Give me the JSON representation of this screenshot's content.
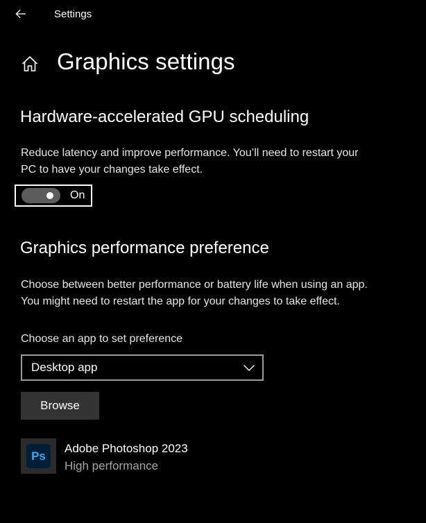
{
  "window": {
    "title": "Settings"
  },
  "page": {
    "title": "Graphics settings"
  },
  "gpu_scheduling": {
    "heading": "Hardware-accelerated GPU scheduling",
    "description_line1": "Reduce latency and improve performance. You’ll need to restart your",
    "description_line2": "PC to have your changes take effect.",
    "toggle_state": "On"
  },
  "performance_preference": {
    "heading": "Graphics performance preference",
    "description_line1": "Choose between better performance or battery life when using an app.",
    "description_line2": "You might need to restart the app for your changes to take effect.",
    "dropdown_label": "Choose an app to set preference",
    "dropdown_value": "Desktop app",
    "browse_label": "Browse"
  },
  "apps": [
    {
      "icon": "photoshop-icon",
      "icon_text": "Ps",
      "name": "Adobe Photoshop 2023",
      "preference": "High performance"
    }
  ],
  "colors": {
    "background": "#000000",
    "text": "#ffffff",
    "secondary_text": "#a6a6a6",
    "toggle_track": "#5c5c5c",
    "button_bg": "#333333",
    "ps_icon_bg": "#001e36",
    "ps_icon_text": "#31a8ff"
  },
  "icons": {
    "back": "back-arrow-icon",
    "home": "home-icon",
    "dropdown": "chevron-down-icon"
  }
}
